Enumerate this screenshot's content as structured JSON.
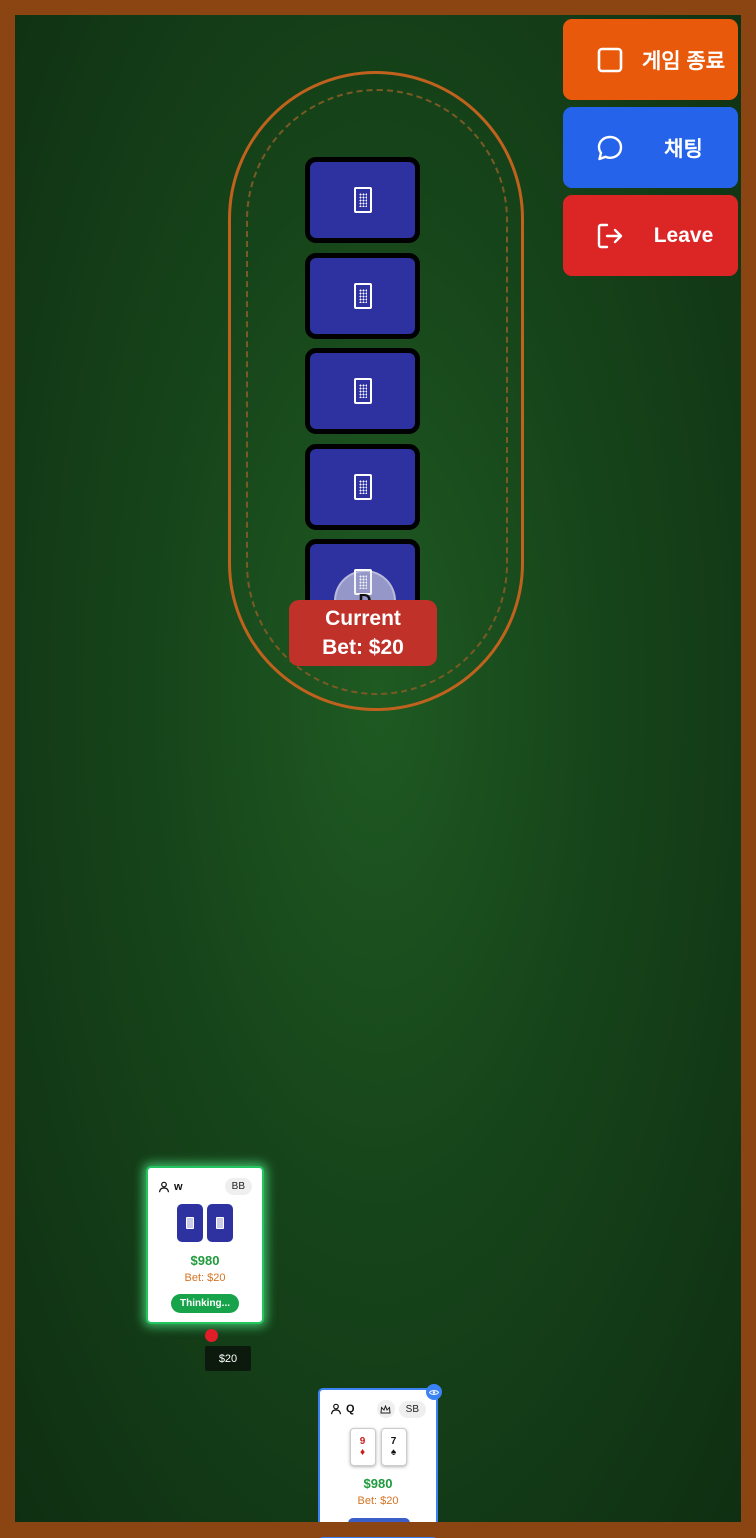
{
  "buttons": {
    "end_game": "게임 종료",
    "chat": "채팅",
    "leave": "Leave"
  },
  "colors": {
    "end_game": "#e8590c",
    "chat": "#2563eb",
    "leave": "#dc2626",
    "table_rail": "#8B4513",
    "felt": "#1a4d1e",
    "card_back": "#2d32a0"
  },
  "community": {
    "cards": [
      "card-back",
      "card-back",
      "card-back",
      "card-back",
      "card-back"
    ],
    "dealer_label": "D",
    "current_bet_line1": "Current",
    "current_bet_line2": "Bet: $20"
  },
  "players": [
    {
      "name": "w",
      "position": "BB",
      "chips": "$980",
      "bet": "Bet: $20",
      "status": "Thinking...",
      "table_bet": "$20"
    },
    {
      "name": "Q",
      "position": "SB",
      "chips": "$980",
      "bet": "Bet: $20",
      "cards": [
        {
          "rank": "9",
          "suit": "♦"
        },
        {
          "rank": "7",
          "suit": "♠"
        }
      ]
    }
  ]
}
